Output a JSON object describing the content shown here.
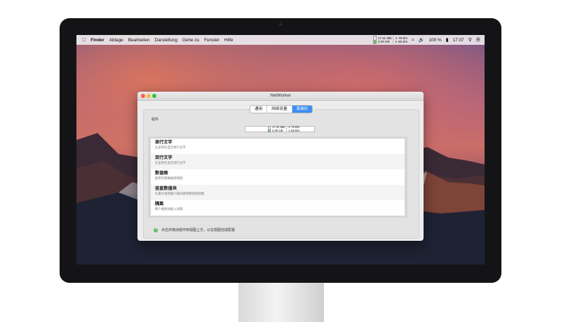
{
  "menubar": {
    "app_name": "Finder",
    "menus": [
      "Ablage",
      "Bearbeiten",
      "Darstellung",
      "Gehe zu",
      "Fenster",
      "Hilfe"
    ],
    "memory_used": "17.31 MB",
    "memory_free": "2.09 GB",
    "net_up": "∧ 78 B/s",
    "net_down": "∨ 86 B/s",
    "battery": "100 %",
    "time": "17:37"
  },
  "window": {
    "title": "NetWorker",
    "tabs": [
      {
        "label": "通用",
        "active": false
      },
      {
        "label": "网络流量",
        "active": false
      },
      {
        "label": "菜单栏",
        "active": true
      }
    ],
    "section_label": "组件",
    "preview": {
      "memory_used": "17.31 MB",
      "memory_free": "2.09 GB",
      "net_up": "∧ 78 B/s",
      "net_down": "∨ 86 B/s"
    },
    "components": [
      {
        "title": "单行文字",
        "subtitle": "在菜单栏显示单行文字"
      },
      {
        "title": "双行文字",
        "subtitle": "在菜单栏显示双行文字"
      },
      {
        "title": "数值图",
        "subtitle": "使用可用数据绘制图"
      },
      {
        "title": "竖直数值块",
        "subtitle": "在最大值和最小值间使用数值绘制图"
      },
      {
        "title": "隔离",
        "subtitle": "两个视图间插入间隔"
      }
    ],
    "hint": "点击并拖动组件到视图上方，以在视图完成配置"
  }
}
